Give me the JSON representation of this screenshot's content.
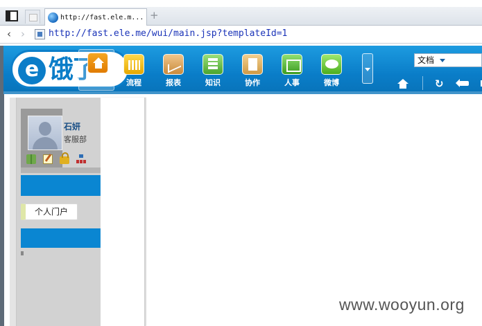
{
  "browser": {
    "tab_title": "http://fast.ele.m...",
    "new_tab_symbol": "+",
    "back_symbol": "‹",
    "forward_symbol": "›",
    "url": "http://fast.ele.me/wui/main.jsp?templateId=1"
  },
  "app": {
    "logo_letter": "e",
    "logo_text": "饿了",
    "nav_items": [
      {
        "label": "",
        "icon": "home-icon"
      },
      {
        "label": "流程",
        "icon": "workflow-icon"
      },
      {
        "label": "报表",
        "icon": "report-icon"
      },
      {
        "label": "知识",
        "icon": "knowledge-icon"
      },
      {
        "label": "协作",
        "icon": "collaboration-icon"
      },
      {
        "label": "人事",
        "icon": "hr-icon"
      },
      {
        "label": "微博",
        "icon": "weibo-icon"
      }
    ],
    "search_type": "文档",
    "refresh_symbol": "↻",
    "accent_color": "#0a86d2"
  },
  "sidebar": {
    "user_name": "石妍",
    "department": "客服部",
    "quick_icons": [
      "book-icon",
      "note-icon",
      "lock-icon",
      "org-chart-icon"
    ],
    "portal_label": "个人门户"
  },
  "watermark": "www.wooyun.org"
}
